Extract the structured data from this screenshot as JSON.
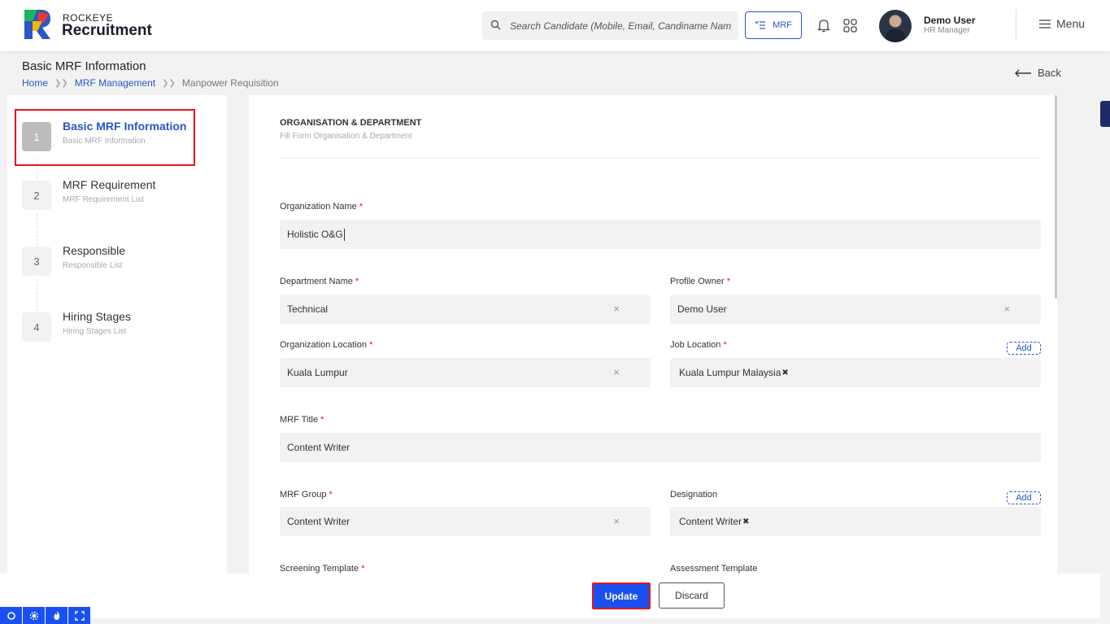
{
  "header": {
    "brand_small": "ROCKEYE",
    "brand_big": "Recruitment",
    "search_placeholder": "Search Candidate (Mobile, Email, Candiname Name)",
    "mrf_label": "MRF",
    "user_name": "Demo User",
    "user_role": "HR Manager",
    "menu_label": "Menu"
  },
  "page": {
    "title": "Basic MRF Information",
    "breadcrumb": [
      "Home",
      "MRF Management",
      "Manpower Requisition"
    ],
    "back_label": "Back"
  },
  "steps": [
    {
      "num": "1",
      "title": "Basic MRF Information",
      "subtitle": "Basic MRF Information",
      "active": true
    },
    {
      "num": "2",
      "title": "MRF Requirement",
      "subtitle": "MRF Requirement List"
    },
    {
      "num": "3",
      "title": "Responsible",
      "subtitle": "Responsible List"
    },
    {
      "num": "4",
      "title": "Hiring Stages",
      "subtitle": "Hiring Stages List"
    }
  ],
  "form": {
    "section_title": "ORGANISATION & DEPARTMENT",
    "section_subtitle": "Fill Form Organisation & Department",
    "org_name_label": "Organization Name",
    "org_name_value": "Holistic O&G",
    "dept_label": "Department Name",
    "dept_value": "Technical",
    "owner_label": "Profile Owner",
    "owner_value": "Demo User",
    "org_loc_label": "Organization Location",
    "org_loc_value": "Kuala Lumpur",
    "job_loc_label": "Job Location",
    "job_loc_value": "Kuala Lumpur Malaysia",
    "add_label": "Add",
    "mrf_title_label": "MRF Title",
    "mrf_title_value": "Content Writer",
    "mrf_group_label": "MRF Group",
    "mrf_group_value": "Content Writer",
    "designation_label": "Designation",
    "designation_value": "Content Writer",
    "screening_label": "Screening Template",
    "assessment_label": "Assessment Template",
    "required_mark": "*",
    "clear_glyph": "×"
  },
  "footer": {
    "update_label": "Update",
    "discard_label": "Discard"
  },
  "colors": {
    "accent": "#2a56c6",
    "primary_button": "#1a50f0",
    "highlight_border": "#e0141e"
  }
}
